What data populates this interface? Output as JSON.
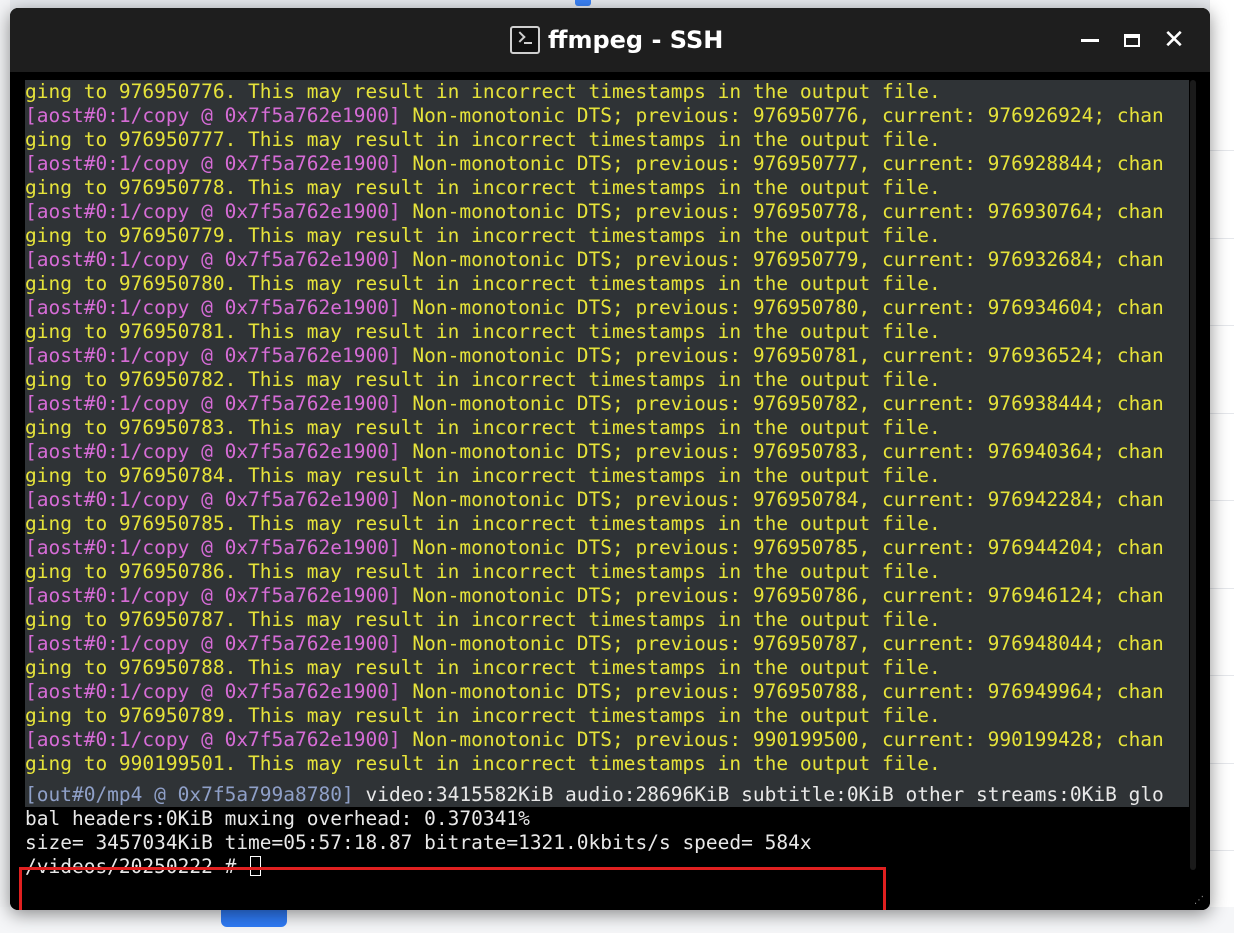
{
  "window": {
    "title": "ffmpeg - SSH",
    "controls": {
      "minimize": "minimize",
      "maximize": "maximize",
      "close": "✕"
    }
  },
  "terminal": {
    "scrollback": [
      {
        "tag": "",
        "text": "ging to 976950776. This may result in incorrect timestamps in the output file."
      },
      {
        "tag": "[aost#0:1/copy @ 0x7f5a762e1900]",
        "text": " Non-monotonic DTS; previous: 976950776, current: 976926924; chan"
      },
      {
        "tag": "",
        "text": "ging to 976950777. This may result in incorrect timestamps in the output file."
      },
      {
        "tag": "[aost#0:1/copy @ 0x7f5a762e1900]",
        "text": " Non-monotonic DTS; previous: 976950777, current: 976928844; chan"
      },
      {
        "tag": "",
        "text": "ging to 976950778. This may result in incorrect timestamps in the output file."
      },
      {
        "tag": "[aost#0:1/copy @ 0x7f5a762e1900]",
        "text": " Non-monotonic DTS; previous: 976950778, current: 976930764; chan"
      },
      {
        "tag": "",
        "text": "ging to 976950779. This may result in incorrect timestamps in the output file."
      },
      {
        "tag": "[aost#0:1/copy @ 0x7f5a762e1900]",
        "text": " Non-monotonic DTS; previous: 976950779, current: 976932684; chan"
      },
      {
        "tag": "",
        "text": "ging to 976950780. This may result in incorrect timestamps in the output file."
      },
      {
        "tag": "[aost#0:1/copy @ 0x7f5a762e1900]",
        "text": " Non-monotonic DTS; previous: 976950780, current: 976934604; chan"
      },
      {
        "tag": "",
        "text": "ging to 976950781. This may result in incorrect timestamps in the output file."
      },
      {
        "tag": "[aost#0:1/copy @ 0x7f5a762e1900]",
        "text": " Non-monotonic DTS; previous: 976950781, current: 976936524; chan"
      },
      {
        "tag": "",
        "text": "ging to 976950782. This may result in incorrect timestamps in the output file."
      },
      {
        "tag": "[aost#0:1/copy @ 0x7f5a762e1900]",
        "text": " Non-monotonic DTS; previous: 976950782, current: 976938444; chan"
      },
      {
        "tag": "",
        "text": "ging to 976950783. This may result in incorrect timestamps in the output file."
      },
      {
        "tag": "[aost#0:1/copy @ 0x7f5a762e1900]",
        "text": " Non-monotonic DTS; previous: 976950783, current: 976940364; chan"
      },
      {
        "tag": "",
        "text": "ging to 976950784. This may result in incorrect timestamps in the output file."
      },
      {
        "tag": "[aost#0:1/copy @ 0x7f5a762e1900]",
        "text": " Non-monotonic DTS; previous: 976950784, current: 976942284; chan"
      },
      {
        "tag": "",
        "text": "ging to 976950785. This may result in incorrect timestamps in the output file."
      },
      {
        "tag": "[aost#0:1/copy @ 0x7f5a762e1900]",
        "text": " Non-monotonic DTS; previous: 976950785, current: 976944204; chan"
      },
      {
        "tag": "",
        "text": "ging to 976950786. This may result in incorrect timestamps in the output file."
      },
      {
        "tag": "[aost#0:1/copy @ 0x7f5a762e1900]",
        "text": " Non-monotonic DTS; previous: 976950786, current: 976946124; chan"
      },
      {
        "tag": "",
        "text": "ging to 976950787. This may result in incorrect timestamps in the output file."
      },
      {
        "tag": "[aost#0:1/copy @ 0x7f5a762e1900]",
        "text": " Non-monotonic DTS; previous: 976950787, current: 976948044; chan"
      },
      {
        "tag": "",
        "text": "ging to 976950788. This may result in incorrect timestamps in the output file."
      },
      {
        "tag": "[aost#0:1/copy @ 0x7f5a762e1900]",
        "text": " Non-monotonic DTS; previous: 976950788, current: 976949964; chan"
      },
      {
        "tag": "",
        "text": "ging to 976950789. This may result in incorrect timestamps in the output file."
      },
      {
        "tag": "[aost#0:1/copy @ 0x7f5a762e1900]",
        "text": " Non-monotonic DTS; previous: 990199500, current: 990199428; chan"
      },
      {
        "tag": "",
        "text": "ging to 990199501. This may result in incorrect timestamps in the output file."
      }
    ],
    "summary_tag": "[out#0/mp4 @ 0x7f5a799a8780]",
    "summary_text": " video:3415582KiB audio:28696KiB subtitle:0KiB other streams:0KiB glo",
    "final_lines": {
      "headers": "bal headers:0KiB muxing overhead: 0.370341%",
      "stats": "size= 3457034KiB time=05:57:18.87 bitrate=1321.0kbits/s speed= 584x",
      "prompt": "/videos/20250222 # "
    }
  },
  "colors": {
    "tag": "#d66cd6",
    "warning_text": "#e6e33a",
    "highlight_box": "#e02020",
    "scrollback_bg": "#2f3336",
    "titlebar_bg": "#1e1e1e"
  },
  "icons": {
    "app": "terminal-icon",
    "minimize": "minimize-icon",
    "maximize": "maximize-icon",
    "close": "close-icon"
  }
}
